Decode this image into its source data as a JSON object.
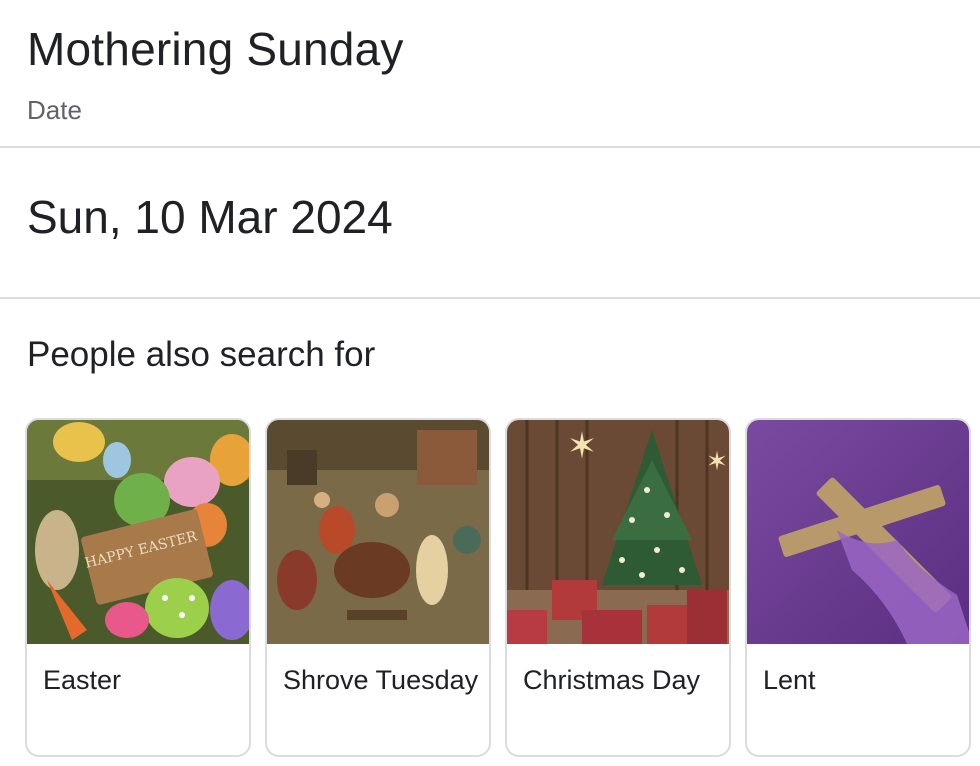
{
  "header": {
    "title": "Mothering Sunday",
    "subtitle": "Date"
  },
  "answer": {
    "date": "Sun, 10 Mar 2024"
  },
  "related": {
    "heading": "People also search for",
    "items": [
      {
        "label": "Easter",
        "thumb_text": "HAPPY EASTER"
      },
      {
        "label": "Shrove Tuesday"
      },
      {
        "label": "Christmas Day"
      },
      {
        "label": "Lent"
      }
    ]
  },
  "colors": {
    "text_primary": "#202124",
    "text_secondary": "#5f6368",
    "divider": "#dadce0"
  }
}
